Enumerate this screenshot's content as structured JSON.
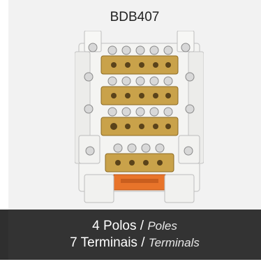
{
  "product": {
    "model_code": "BDB407",
    "image_icon": "distribution-block-image"
  },
  "caption": {
    "poles_pt": "4 Polos",
    "separator": "/",
    "poles_en": "Poles",
    "terminals_pt": "7 Terminais",
    "terminals_en": "Terminals"
  },
  "colors": {
    "panel_bg": "#f2f2f2",
    "caption_bg": "#333333",
    "brass": "#c9a24a",
    "housing": "#f4f4f2",
    "accent_orange": "#e8742a"
  }
}
